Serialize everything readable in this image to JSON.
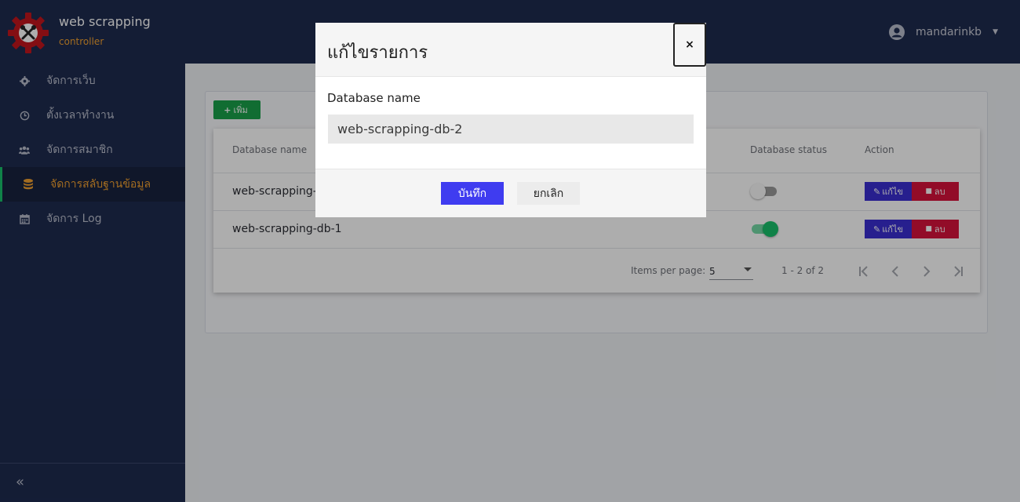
{
  "brand": {
    "title": "web scrapping",
    "subtitle": "controller"
  },
  "user": {
    "name": "mandarinkb"
  },
  "sidebar": {
    "items": [
      {
        "label": "จัดการเว็บ",
        "icon": "gear-icon"
      },
      {
        "label": "ตั้งเวลาทำงาน",
        "icon": "clock-icon"
      },
      {
        "label": "จัดการสมาชิก",
        "icon": "users-icon"
      },
      {
        "label": "จัดการสลับฐานข้อมูล",
        "icon": "database-icon"
      },
      {
        "label": "จัดการ Log",
        "icon": "calendar-icon"
      }
    ],
    "active_index": 3,
    "collapse_glyph": "«"
  },
  "toolbar": {
    "add_label": "เพิ่ม"
  },
  "table": {
    "headers": [
      "Database name",
      "Database status",
      "Action"
    ],
    "rows": [
      {
        "name": "web-scrapping-db-2",
        "status": false,
        "edit_label": "แก้ไข",
        "delete_label": "ลบ"
      },
      {
        "name": "web-scrapping-db-1",
        "status": true,
        "edit_label": "แก้ไข",
        "delete_label": "ลบ"
      }
    ]
  },
  "pager": {
    "items_per_page_label": "Items per page:",
    "page_size": "5",
    "range_text": "1 - 2 of 2"
  },
  "modal": {
    "title": "แก้ไขรายการ",
    "close_glyph": "×",
    "field_label": "Database name",
    "field_value": "web-scrapping-db-2",
    "save_label": "บันทึก",
    "cancel_label": "ยกเลิก"
  },
  "colors": {
    "sidebar_bg": "#1e2b4f",
    "accent_orange": "#f0a030",
    "active_marker": "#18c06a",
    "add_green": "#1aa14a",
    "edit_blue": "#3a2fd1",
    "delete_red": "#d8133c",
    "save_blue": "#3f3cf0",
    "toggle_on": "#18c06a"
  }
}
